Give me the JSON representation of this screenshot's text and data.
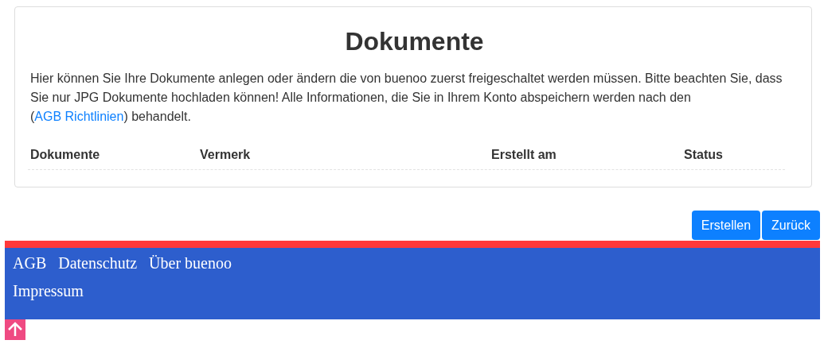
{
  "card": {
    "title": "Dokumente",
    "intro": {
      "before": "Hier können Sie Ihre Dokumente anlegen oder ändern die von buenoo zuerst freigeschaltet werden müssen. Bitte beachten Sie, dass Sie nur JPG Dokumente hochladen können! Alle Informationen, die Sie in Ihrem Konto abspeichern werden nach den (",
      "link": "AGB Richtlinien",
      "after": ") behandelt."
    },
    "table": {
      "columns": [
        "Dokumente",
        "Vermerk",
        "Erstellt am",
        "Status"
      ]
    }
  },
  "buttons": [
    "Erstellen",
    "Zurück"
  ],
  "footer": {
    "link_rows": [
      [
        "AGB",
        "Datenschutz",
        "Über buenoo"
      ],
      [
        "Impressum"
      ]
    ]
  }
}
